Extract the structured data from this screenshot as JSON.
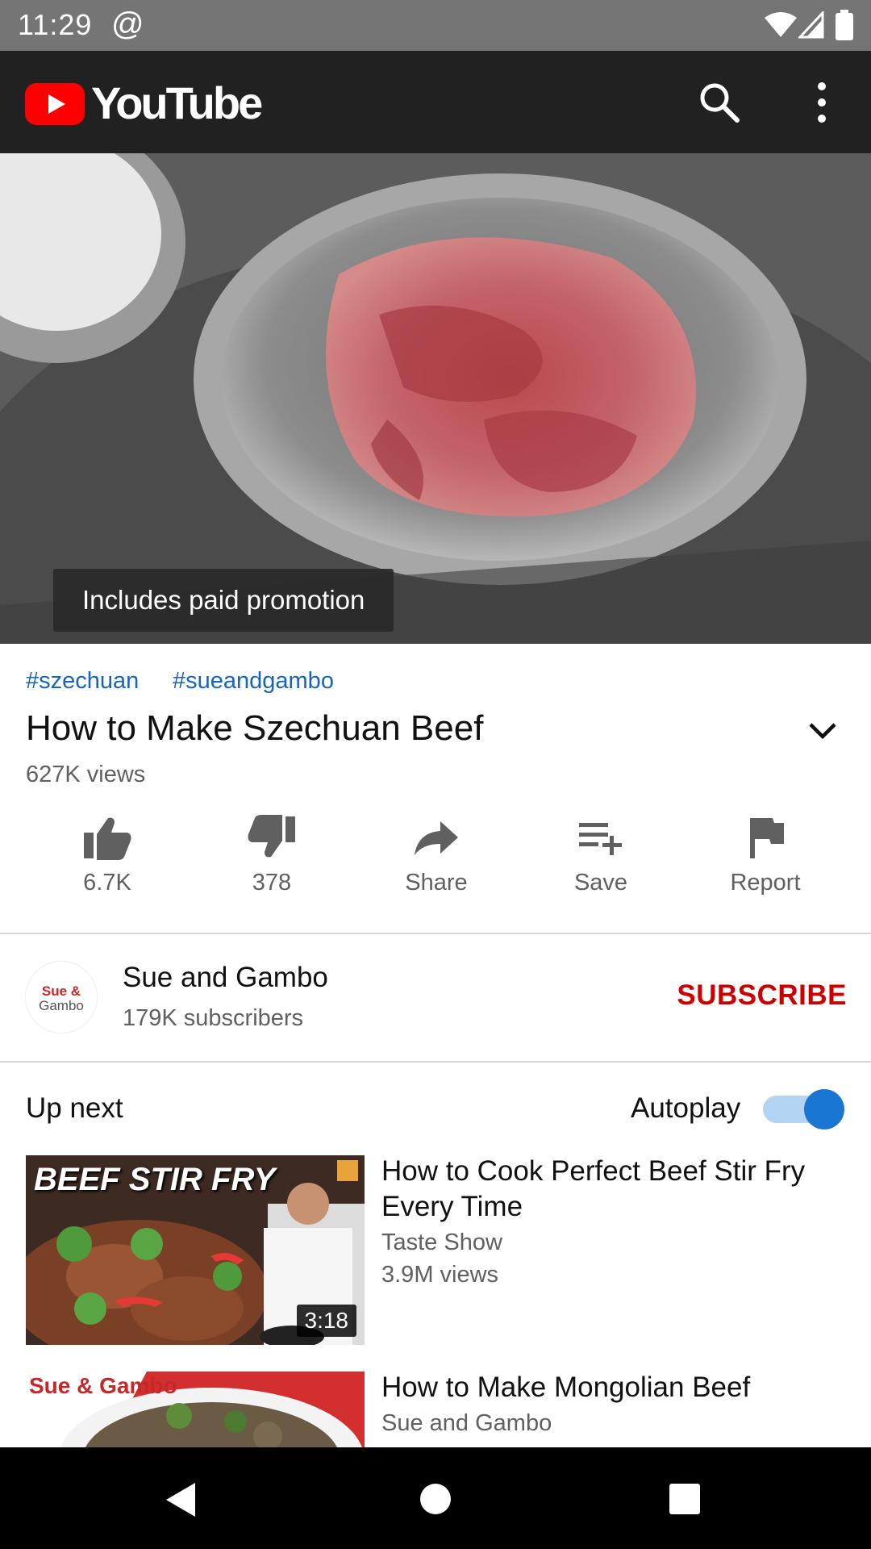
{
  "status_bar": {
    "time": "11:29"
  },
  "app_bar": {
    "logo_text": "YouTube"
  },
  "video": {
    "promo_label": "Includes paid promotion"
  },
  "tags": [
    "#szechuan",
    "#sueandgambo"
  ],
  "title": "How to Make Szechuan Beef",
  "views": "627K views",
  "actions": {
    "like": "6.7K",
    "dislike": "378",
    "share": "Share",
    "save": "Save",
    "report": "Report"
  },
  "channel": {
    "avatar_text": "Sue & Gambo",
    "name": "Sue and Gambo",
    "subscribers": "179K subscribers",
    "subscribe_label": "SUBSCRIBE"
  },
  "up_next": {
    "heading": "Up next",
    "autoplay_label": "Autoplay",
    "autoplay_on": true,
    "items": [
      {
        "thumb_text": "BEEF STIR FRY",
        "duration": "3:18",
        "title": "How to Cook Perfect Beef Stir Fry Every Time",
        "channel": "Taste Show",
        "views": "3.9M views"
      },
      {
        "thumb_text": "Sue & Gambo",
        "title": "How to Make Mongolian Beef",
        "channel": "Sue and Gambo"
      }
    ]
  },
  "colors": {
    "accent_red": "#cc0000",
    "link_blue": "#1565c0",
    "toggle_blue": "#1976d2"
  }
}
